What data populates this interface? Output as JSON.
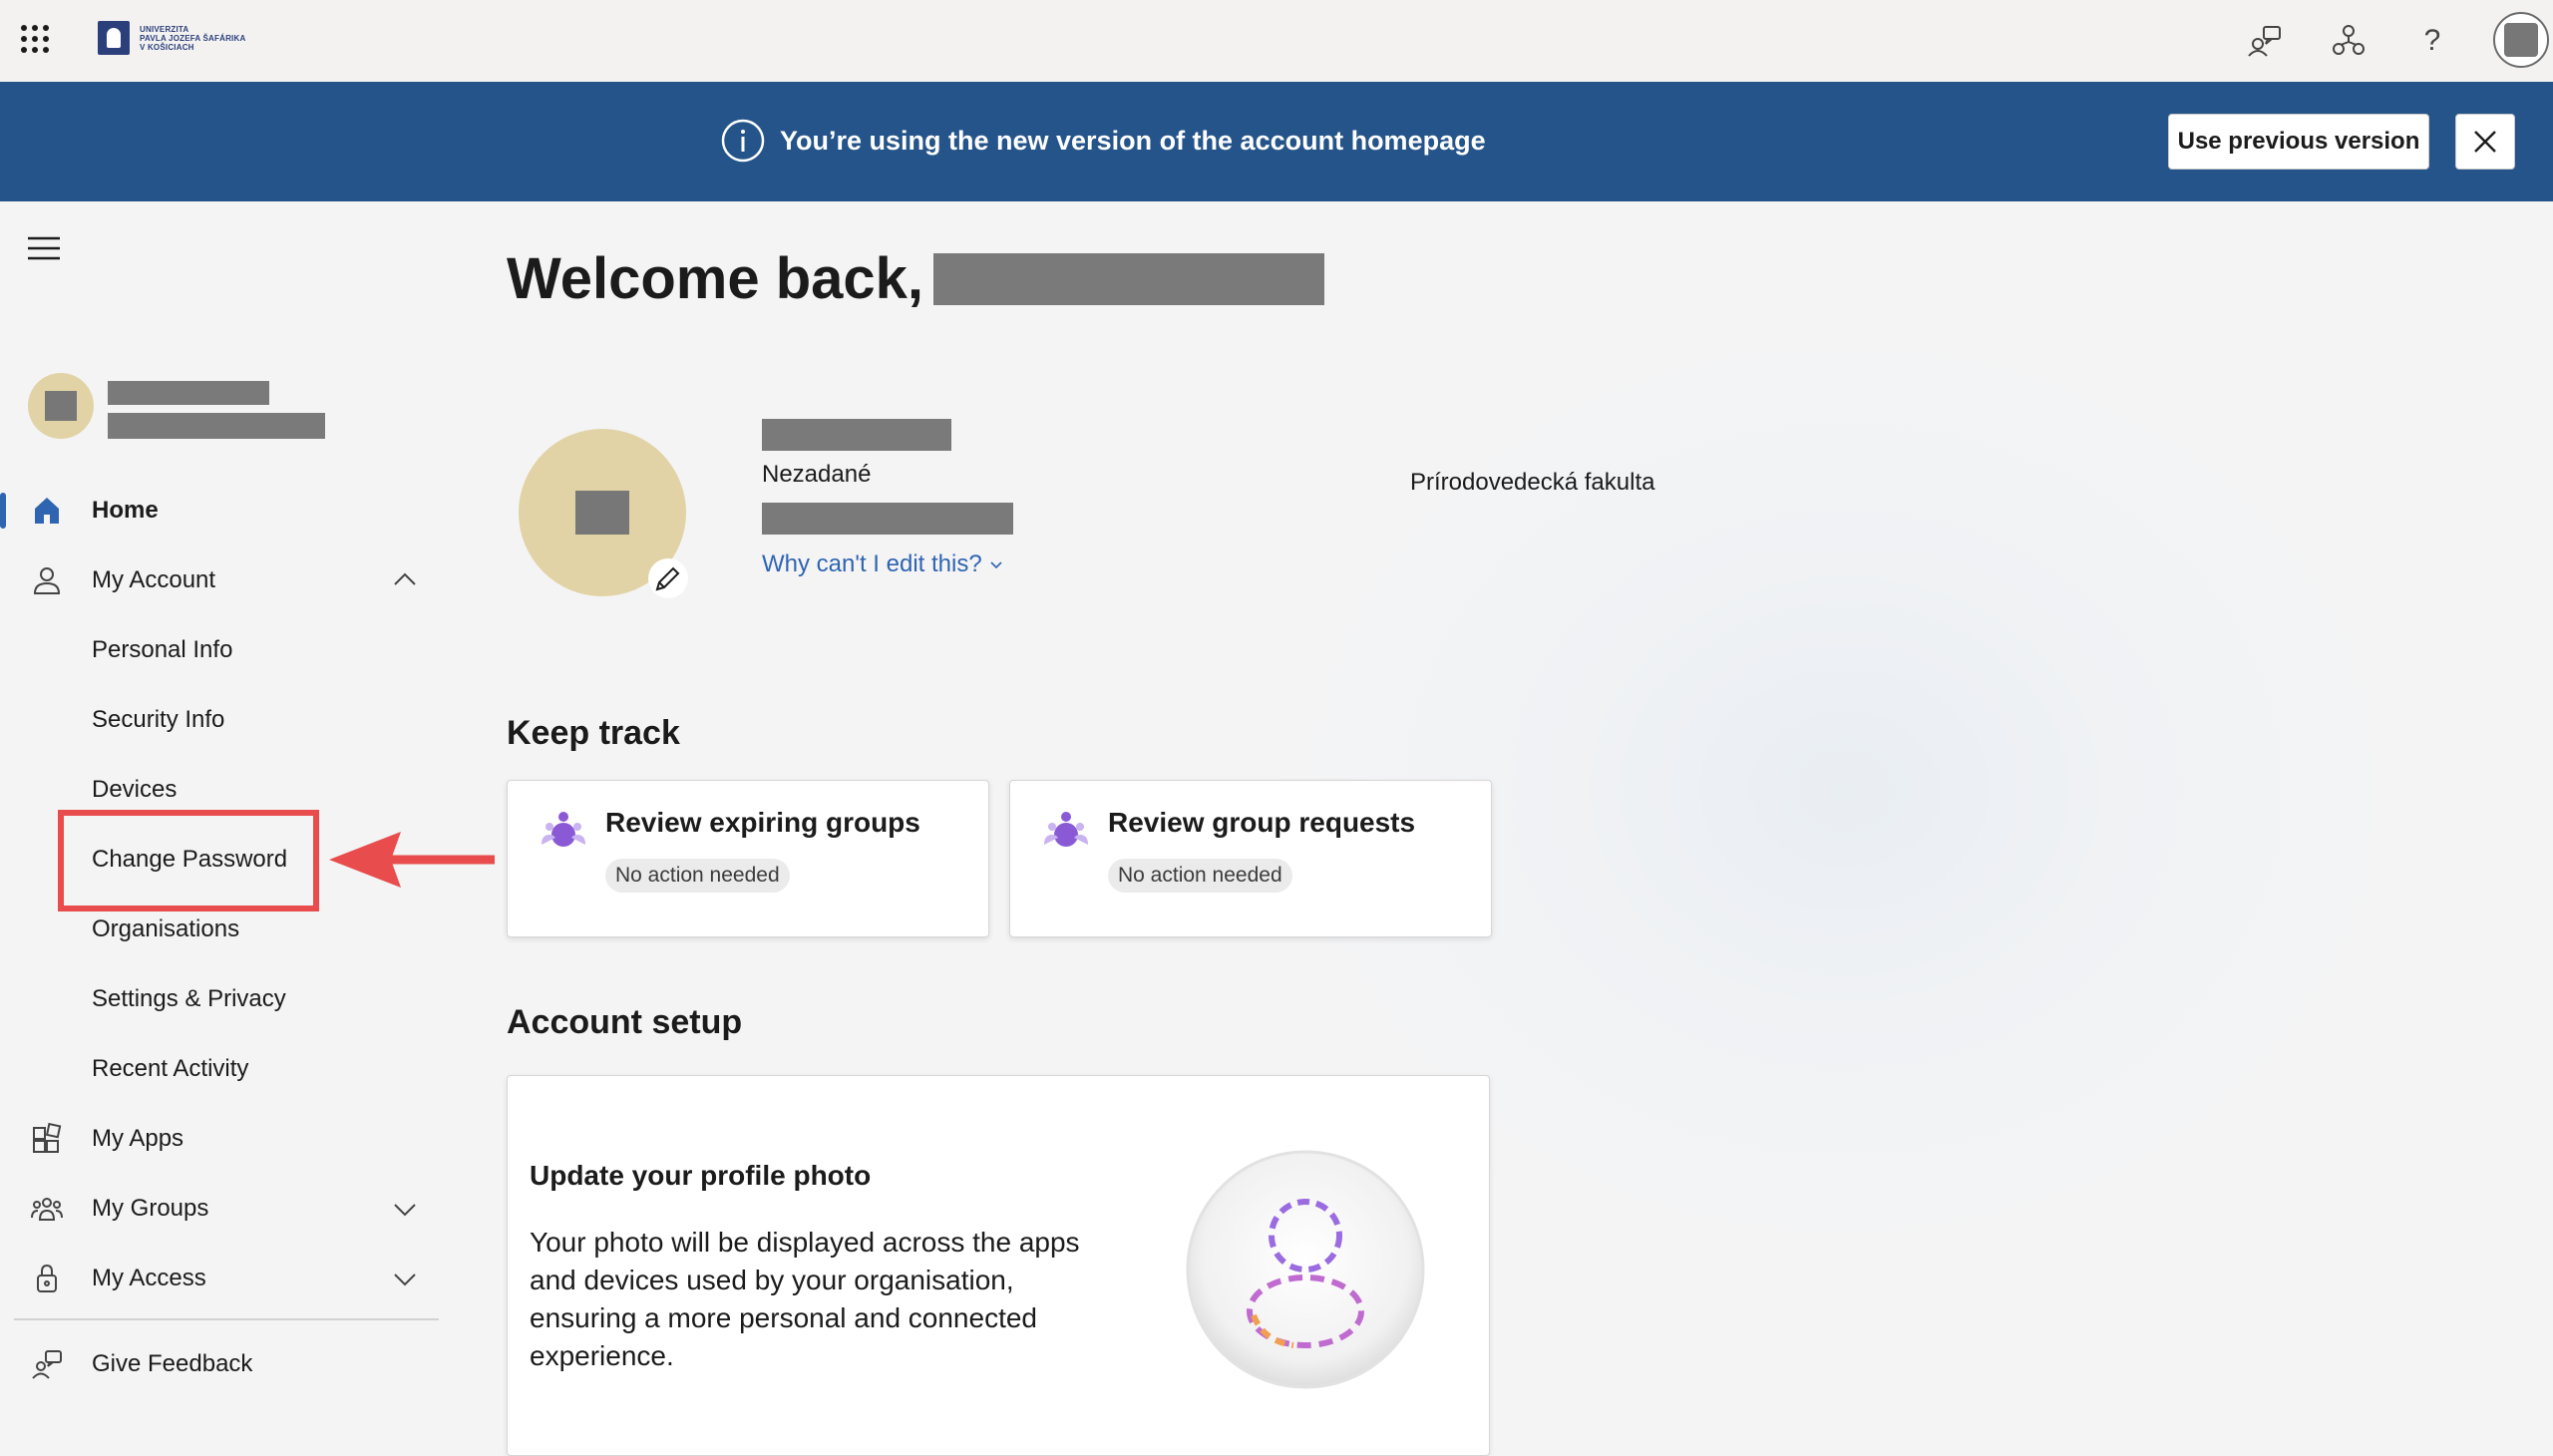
{
  "header": {
    "logo_text_line1": "UNIVERZITA",
    "logo_text_line2": "PAVLA JOZEFA ŠAFÁRIKA",
    "logo_text_line3": "V KOŠICIACH",
    "help_label": "?"
  },
  "banner": {
    "message": "You’re using the new version of the account homepage",
    "previous_version_button": "Use previous version"
  },
  "sidebar": {
    "items": [
      {
        "label": "Home",
        "icon": "home-icon"
      },
      {
        "label": "My Account",
        "icon": "person-icon"
      },
      {
        "label": "Personal Info"
      },
      {
        "label": "Security Info"
      },
      {
        "label": "Devices"
      },
      {
        "label": "Change Password"
      },
      {
        "label": "Organisations"
      },
      {
        "label": "Settings & Privacy"
      },
      {
        "label": "Recent Activity"
      },
      {
        "label": "My Apps",
        "icon": "apps-icon"
      },
      {
        "label": "My Groups",
        "icon": "groups-icon"
      },
      {
        "label": "My Access",
        "icon": "lock-icon"
      },
      {
        "label": "Give Feedback",
        "icon": "feedback-icon"
      }
    ]
  },
  "main": {
    "welcome": "Welcome back,",
    "profile": {
      "department": "Nezadané",
      "faculty": "Prírodovedecká fakulta",
      "edit_link": "Why can't I edit this?"
    },
    "keep_track": {
      "title": "Keep track",
      "cards": [
        {
          "title": "Review expiring groups",
          "status": "No action needed"
        },
        {
          "title": "Review group requests",
          "status": "No action needed"
        }
      ]
    },
    "account_setup": {
      "title": "Account setup",
      "card_title": "Update your profile photo",
      "card_description": "Your photo will be displayed across the apps and devices used by your organisation, ensuring a more personal and connected experience."
    }
  },
  "colors": {
    "banner": "#245489",
    "accent": "#2f64b0",
    "annotation": "#e84c4c"
  }
}
